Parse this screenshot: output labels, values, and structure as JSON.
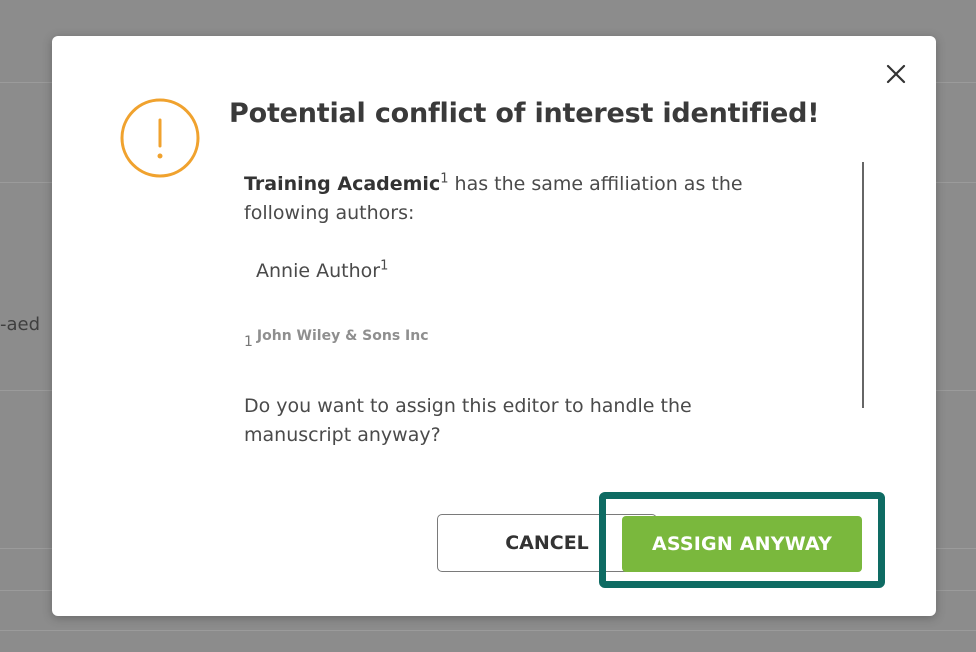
{
  "background": {
    "partial_text": "-aed"
  },
  "dialog": {
    "title": "Potential conflict of interest identified!",
    "editor_name": "Training Academic",
    "editor_sup": "1",
    "same_affiliation_text": " has the same affiliation as the following authors:",
    "author_name": "Annie Author",
    "author_sup": "1",
    "affiliation_number": "1",
    "affiliation_name": "John Wiley & Sons Inc",
    "question": "Do you want to assign this editor to handle the manuscript anyway?",
    "cancel_label": "CANCEL",
    "assign_label": "ASSIGN ANYWAY"
  },
  "colors": {
    "warning": "#f0a22e",
    "primary_button": "#7ab83d",
    "highlight_frame": "#0e6b63"
  },
  "icons": {
    "warning": "warning-circle-icon",
    "close": "close-icon"
  }
}
